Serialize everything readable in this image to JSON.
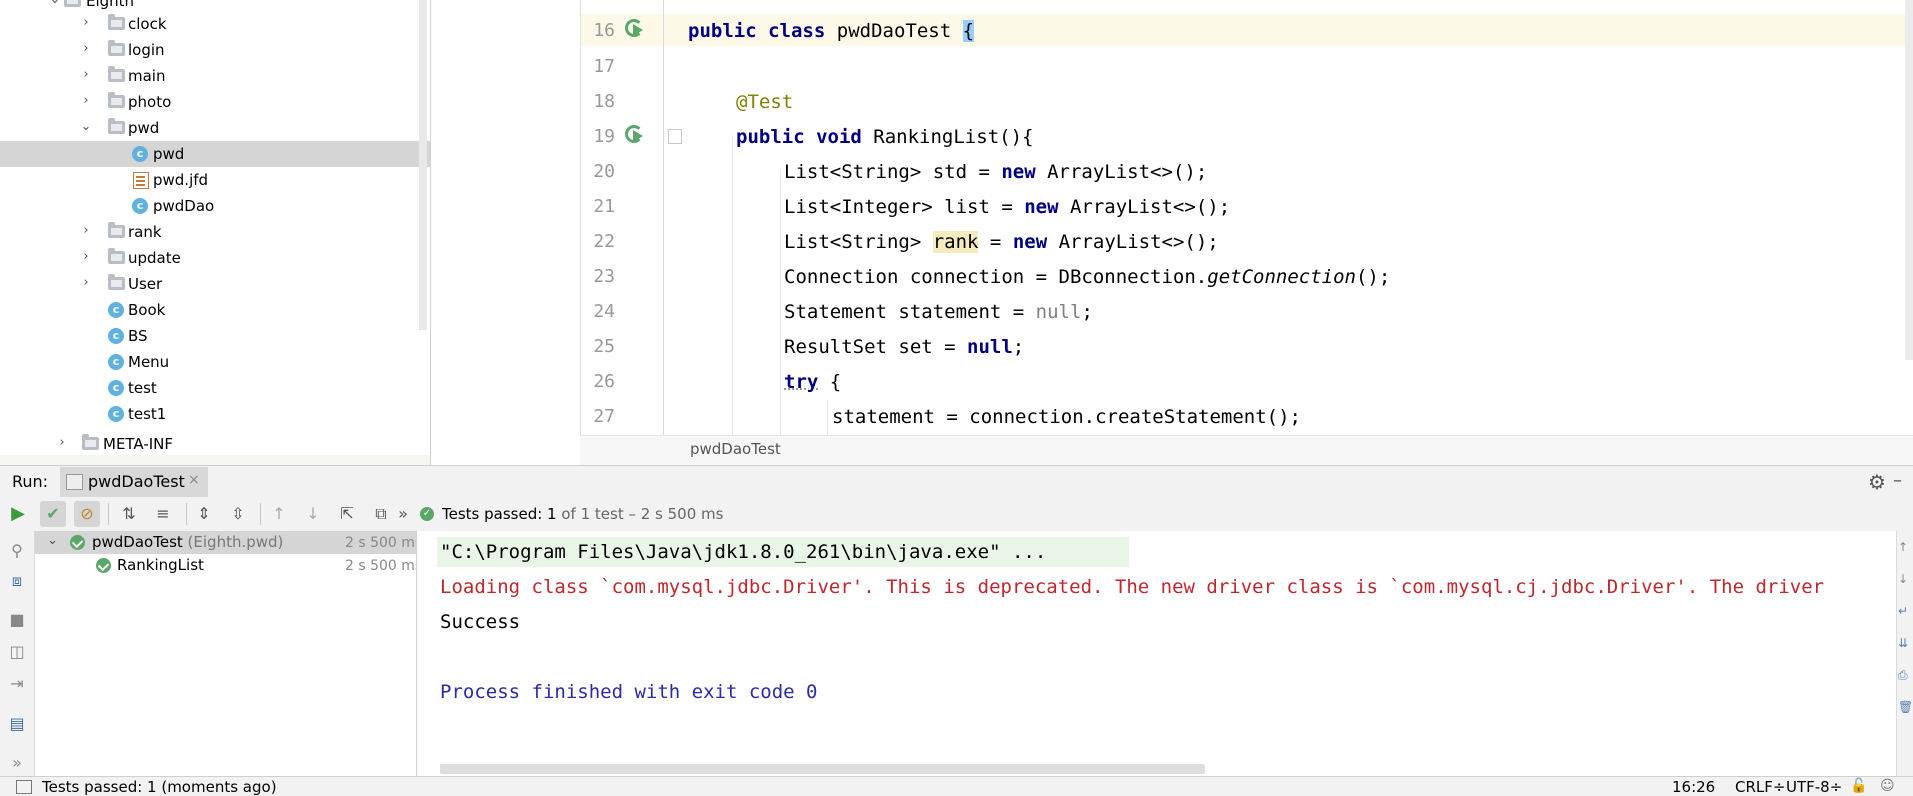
{
  "project_tree": {
    "partial_top": "Eighth",
    "items": [
      {
        "label": "clock",
        "type": "folder",
        "expanded": false
      },
      {
        "label": "login",
        "type": "folder",
        "expanded": false
      },
      {
        "label": "main",
        "type": "folder",
        "expanded": false
      },
      {
        "label": "photo",
        "type": "folder",
        "expanded": false
      },
      {
        "label": "pwd",
        "type": "folder",
        "expanded": true
      },
      {
        "label": "pwd",
        "type": "class",
        "selected": true
      },
      {
        "label": "pwd.jfd",
        "type": "form-file"
      },
      {
        "label": "pwdDao",
        "type": "class"
      },
      {
        "label": "rank",
        "type": "folder",
        "expanded": false
      },
      {
        "label": "update",
        "type": "folder",
        "expanded": false
      },
      {
        "label": "User",
        "type": "folder",
        "expanded": false
      },
      {
        "label": "Book",
        "type": "class"
      },
      {
        "label": "BS",
        "type": "class"
      },
      {
        "label": "Menu",
        "type": "class"
      },
      {
        "label": "test",
        "type": "class"
      },
      {
        "label": "test1",
        "type": "class"
      },
      {
        "label": "META-INF",
        "type": "folder",
        "expanded": false
      }
    ],
    "class_icon_letter": "c"
  },
  "editor": {
    "line_numbers": [
      "16",
      "17",
      "18",
      "19",
      "20",
      "21",
      "22",
      "23",
      "24",
      "25",
      "26",
      "27"
    ],
    "current_line": "16",
    "breadcrumb": "pwdDaoTest",
    "tokens": {
      "public": "public",
      "class": "class",
      "class_name": "pwdDaoTest ",
      "open_brace": "{",
      "annotation": "@Test",
      "void": "void",
      "method_sig": " RankingList(){",
      "l20_a": "List<String> std = ",
      "new": "new",
      "l20_b": " ArrayList<>();",
      "l21_a": "List<Integer> list = ",
      "l22_a": "List<String> ",
      "l22_var": "rank",
      "l22_b": " = ",
      "l23_a": "Connection connection = DBconnection.",
      "l23_method": "getConnection",
      "l23_b": "();",
      "l24_a": "Statement statement = ",
      "null": "null",
      "semicolon": ";",
      "l25_a": "ResultSet set = ",
      "try": "try",
      "l26_b": " {",
      "l27": "statement = connection.createStatement();"
    }
  },
  "run_window": {
    "label": "Run:",
    "tab_label": "pwdDaoTest",
    "tab_close": "×",
    "status_prefix": "Tests passed: ",
    "status_count": "1",
    "status_suffix": " of 1 test – 2 s 500 ms",
    "toolbar_more": "»",
    "tests": [
      {
        "name": "pwdDaoTest",
        "context": " (Eighth.pwd)",
        "time": "2 s 500 ms"
      },
      {
        "name": "RankingList",
        "context": "",
        "time": "2 s 500 ms"
      }
    ],
    "console": {
      "command": "\"C:\\Program Files\\Java\\jdk1.8.0_261\\bin\\java.exe\" ...",
      "warning": "Loading class `com.mysql.jdbc.Driver'. This is deprecated. The new driver class is `com.mysql.cj.jdbc.Driver'. The driver",
      "output": "Success",
      "finished": "Process finished with exit code 0"
    }
  },
  "statusbar": {
    "text": "Tests passed: 1 (moments ago)",
    "position": "16:26",
    "line_sep": "CRLF÷",
    "encoding": "UTF-8÷"
  },
  "colors": {
    "keyword": "#000080",
    "annotation": "#808000",
    "error_text": "#c0272d",
    "info_text": "#2a2aa6",
    "pass_green": "#59a869"
  }
}
